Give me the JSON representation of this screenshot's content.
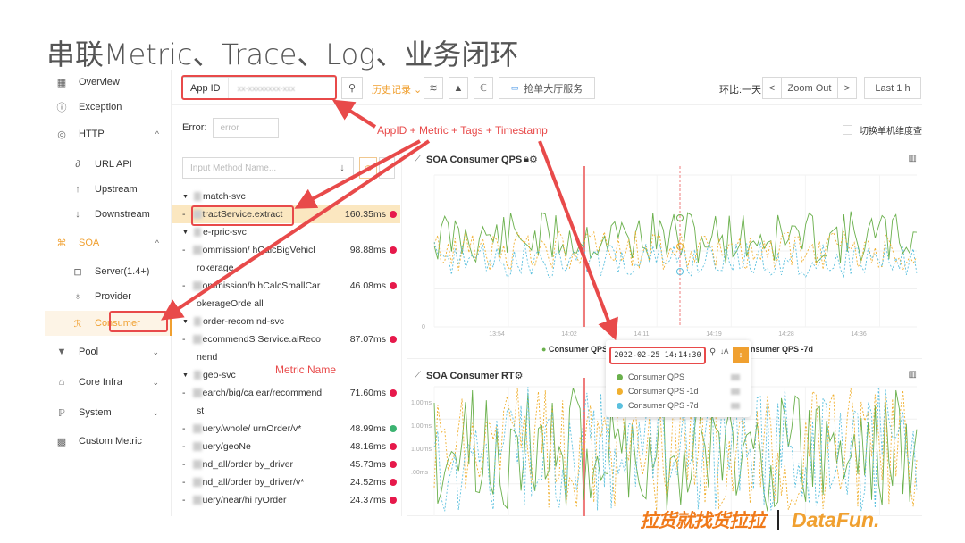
{
  "slide": {
    "title": "串联Metric、Trace、Log、业务闭环"
  },
  "sidebar": {
    "items": [
      {
        "label": "Overview",
        "icon": "grid-icon",
        "glyph": "▦"
      },
      {
        "label": "Exception",
        "icon": "exclamation-circle-icon",
        "glyph": "ⓘ"
      },
      {
        "label": "HTTP",
        "icon": "globe-icon",
        "glyph": "◎",
        "chevron": "^"
      },
      {
        "label": "URL API",
        "icon": "link-icon",
        "glyph": "∂"
      },
      {
        "label": "Upstream",
        "icon": "arrow-up-icon",
        "glyph": "↑"
      },
      {
        "label": "Downstream",
        "icon": "arrow-down-icon",
        "glyph": "↓"
      },
      {
        "label": "SOA",
        "icon": "command-icon",
        "glyph": "⌘",
        "chevron": "^"
      },
      {
        "label": "Server(1.4+)",
        "icon": "database-icon",
        "glyph": "⊟"
      },
      {
        "label": "Provider",
        "icon": "user-icon",
        "glyph": "♁"
      },
      {
        "label": "Consumer",
        "icon": "user-consumer-icon",
        "glyph": "ℛ"
      },
      {
        "label": "Pool",
        "icon": "funnel-icon",
        "glyph": "▼",
        "chevron": "⌄"
      },
      {
        "label": "Core Infra",
        "icon": "home-icon",
        "glyph": "⌂",
        "chevron": "⌄"
      },
      {
        "label": "System",
        "icon": "system-icon",
        "glyph": "ℙ",
        "chevron": "⌄"
      },
      {
        "label": "Custom Metric",
        "icon": "chart-box-icon",
        "glyph": "▩"
      }
    ]
  },
  "toolbar": {
    "appid_label": "App ID",
    "appid_value": "xx-xxxxxxxx-xxx",
    "search_glyph": "⚲",
    "history_label": "历史记录 ⌄",
    "service_label": "抢单大厅服务",
    "ring_label": "环比:一天",
    "prev_label": "<",
    "zoom_out_label": "Zoom Out",
    "next_label": ">",
    "range_label": "Last 1 h"
  },
  "filters": {
    "error_label": "Error:",
    "error_placeholder": "error",
    "switch_label": "切换单机维度查"
  },
  "annotations": {
    "appid_metric": "AppID + Metric + Tags + Timestamp",
    "metric_name": "Metric Name"
  },
  "method_panel": {
    "search_placeholder": "Input Method Name...",
    "sort_glyph": "↓",
    "rows": [
      {
        "type": "group",
        "name": "match-svc"
      },
      {
        "type": "leaf",
        "name": "tractService.extract",
        "ms": "160.35ms",
        "status": "red",
        "highlight": true
      },
      {
        "type": "group",
        "name": "e-rpric-svc"
      },
      {
        "type": "leaf",
        "name": "ommission/  hCalcBigVehicl",
        "cont": "rokerage",
        "ms": "98.88ms",
        "status": "red"
      },
      {
        "type": "leaf",
        "name": "ommission/b  hCalcSmallCar",
        "cont": "okerageOrde  all",
        "ms": "46.08ms",
        "status": "red"
      },
      {
        "type": "group",
        "name": "order-recom  nd-svc"
      },
      {
        "type": "leaf",
        "name": "ecommendS  Service.aiReco",
        "cont": "nend",
        "ms": "87.07ms",
        "status": "red"
      },
      {
        "type": "group",
        "name": "geo-svc"
      },
      {
        "type": "leaf",
        "name": "earch/big/ca  ear/recommend",
        "cont": "st",
        "ms": "71.60ms",
        "status": "red"
      },
      {
        "type": "leaf",
        "name": "uery/whole/  urnOrder/v*",
        "ms": "48.99ms",
        "status": "green"
      },
      {
        "type": "leaf",
        "name": "uery/geoNe",
        "ms": "48.16ms",
        "status": "red"
      },
      {
        "type": "leaf",
        "name": "nd_all/order  by_driver",
        "ms": "45.73ms",
        "status": "red"
      },
      {
        "type": "leaf",
        "name": "nd_all/order  by_driver/v*",
        "ms": "24.52ms",
        "status": "red"
      },
      {
        "type": "leaf",
        "name": "uery/near/hi  ryOrder",
        "ms": "24.37ms",
        "status": "red"
      }
    ]
  },
  "charts": {
    "qps_title": "SOA Consumer QPS",
    "rt_title": "SOA Consumer RT",
    "legend_qps": "Consumer QPS",
    "legend_7d": "Consumer QPS -7d",
    "x_ticks": [
      "13:54",
      "14:02",
      "14:11",
      "14:19",
      "14:28",
      "14:36"
    ],
    "rt_y_ticks": [
      "1.00ms",
      "1.00ms",
      "1.00ms",
      ".00ms"
    ]
  },
  "tooltip": {
    "time": "2022-02-25 14:14:30",
    "search_glyph": "⚲",
    "sort_glyph": "↓A",
    "series": [
      {
        "name": "Consumer QPS",
        "color": "#6ab04c"
      },
      {
        "name": "Consumer QPS -1d",
        "color": "#f0b030"
      },
      {
        "name": "Consumer QPS -7d",
        "color": "#5bc0de"
      }
    ]
  },
  "footer": {
    "brand": "拉货就找货拉拉",
    "partner": "DataFun."
  },
  "colors": {
    "accent": "#f0a030",
    "annotation": "#e84a4a",
    "series_qps": "#6ab04c",
    "series_1d": "#f0b030",
    "series_7d": "#5bc0de"
  }
}
